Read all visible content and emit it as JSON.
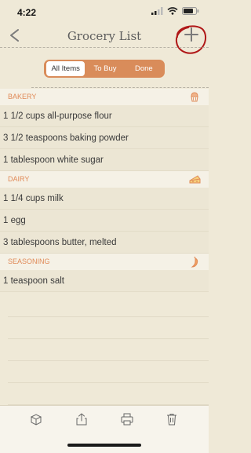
{
  "status": {
    "time": "4:22"
  },
  "nav": {
    "title": "Grocery List"
  },
  "segments": [
    {
      "label": "All Items",
      "active": true
    },
    {
      "label": "To Buy",
      "active": false
    },
    {
      "label": "Done",
      "active": false
    }
  ],
  "sections": [
    {
      "name": "BAKERY",
      "icon": "cupcake-icon",
      "items": [
        "1 1/2 cups all-purpose flour",
        "3 1/2 teaspoons baking powder",
        "1 tablespoon white sugar"
      ]
    },
    {
      "name": "DAIRY",
      "icon": "cheese-icon",
      "items": [
        "1 1/4 cups milk",
        "1 egg",
        "3 tablespoons butter, melted"
      ]
    },
    {
      "name": "SEASONING",
      "icon": "chili-pepper-icon",
      "items": [
        "1 teaspoon salt"
      ]
    }
  ],
  "colors": {
    "accent": "#d98c5a",
    "background": "#efe9d7",
    "annotation": "#b01818"
  }
}
